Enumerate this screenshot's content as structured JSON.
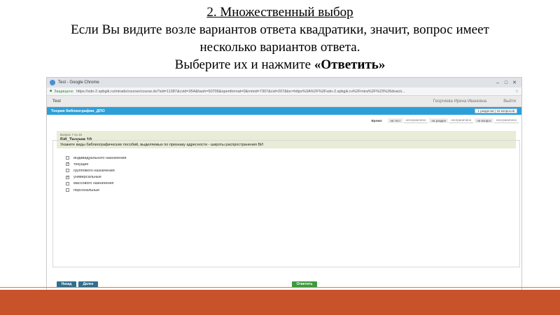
{
  "slide": {
    "title": "2. Множественный выбор",
    "line1": "Если Вы видите возле вариантов ответа квадратики, значит, вопрос имеет",
    "line2": "несколько вариантов ответа.",
    "line3_prefix": "Выберите их и нажмите ",
    "line3_bold": "«Ответить»"
  },
  "browser": {
    "window_title": "Test - Google Chrome",
    "secure_label": "Защищено",
    "url": "https://sdo-2.spbgik.ru/mirads/course/course.do?sid=11387&cvid=354&hash=50706&openformat=0&mmid=7307&cid=207&loc=https%3A%2F%2Fsdo-2.spbgik.ru%2Fmira%2F%23%26doacti..."
  },
  "app": {
    "header_title": "Test",
    "user_name": "Георгиева Ирина Ивановна",
    "logout_label": "Выйти",
    "course_title": "Теория библиографии_ДПО",
    "progress": "1 разделов | 15 вопросов"
  },
  "timer": {
    "label": "Время:",
    "on_test_label": "на тест",
    "on_test_value": "неограничено",
    "on_section_label": "на раздел",
    "on_section_value": "неограничено",
    "on_question_label": "на вопрос",
    "on_question_value": "неограничено"
  },
  "question": {
    "number": "Вопрос 7 из 15",
    "title": "БИ_Теория 10",
    "text": "Укажите виды библиографических пособий, выделяемых по признаку адресности - широты распространения БИ",
    "options": [
      {
        "label": "индивидуального назначения",
        "checked": false
      },
      {
        "label": "текущие",
        "checked": true
      },
      {
        "label": "группового назначения",
        "checked": false
      },
      {
        "label": "универсальные",
        "checked": true
      },
      {
        "label": "массового назначения",
        "checked": false
      },
      {
        "label": "персональные",
        "checked": false
      }
    ]
  },
  "buttons": {
    "back": "Назад",
    "forward": "Далее",
    "answer": "Ответить"
  },
  "colors": {
    "course_bar": "#2d9fd8",
    "answer_button": "#3a9a3f",
    "nav_button": "#2f6f8f",
    "question_bg": "#e9ecd6",
    "slide_bar": "#c8522a"
  }
}
